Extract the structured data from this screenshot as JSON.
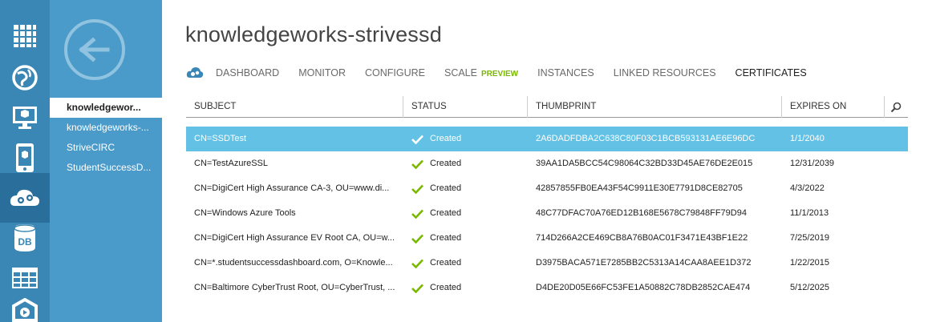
{
  "colors": {
    "rail": "#3a87b5",
    "rail_active": "#2a6f9b",
    "subnav": "#4a9bc9",
    "selected_row": "#62c1e4",
    "check_green": "#7ab800",
    "preview_badge": "#7ab800"
  },
  "rail_icons": [
    "all-items-icon",
    "web-sites-icon",
    "virtual-machines-icon",
    "mobile-services-icon",
    "cloud-services-icon",
    "sql-databases-icon",
    "storage-icon",
    "media-services-icon"
  ],
  "subnav": {
    "items": [
      {
        "label": "knowledgewor..."
      },
      {
        "label": "knowledgeworks-..."
      },
      {
        "label": "StriveCIRC"
      },
      {
        "label": "StudentSuccessD..."
      }
    ]
  },
  "page": {
    "title": "knowledgeworks-strivessd"
  },
  "tabs": [
    {
      "label": "DASHBOARD"
    },
    {
      "label": "MONITOR"
    },
    {
      "label": "CONFIGURE"
    },
    {
      "label": "SCALE",
      "badge": "PREVIEW"
    },
    {
      "label": "INSTANCES"
    },
    {
      "label": "LINKED RESOURCES"
    },
    {
      "label": "CERTIFICATES"
    }
  ],
  "grid": {
    "columns": [
      "SUBJECT",
      "STATUS",
      "THUMBPRINT",
      "EXPIRES ON"
    ],
    "rows": [
      {
        "subject": "CN=SSDTest",
        "status": "Created",
        "thumbprint": "2A6DADFDBA2C638C80F03C1BCB593131AE6E96DC",
        "expires": "1/1/2040"
      },
      {
        "subject": "CN=TestAzureSSL",
        "status": "Created",
        "thumbprint": "39AA1DA5BCC54C98064C32BD33D45AE76DE2E015",
        "expires": "12/31/2039"
      },
      {
        "subject": "CN=DigiCert High Assurance CA-3, OU=www.di...",
        "status": "Created",
        "thumbprint": "42857855FB0EA43F54C9911E30E7791D8CE82705",
        "expires": "4/3/2022"
      },
      {
        "subject": "CN=Windows Azure Tools",
        "status": "Created",
        "thumbprint": "48C77DFAC70A76ED12B168E5678C79848FF79D94",
        "expires": "11/1/2013"
      },
      {
        "subject": "CN=DigiCert High Assurance EV Root CA, OU=w...",
        "status": "Created",
        "thumbprint": "714D266A2CE469CB8A76B0AC01F3471E43BF1E22",
        "expires": "7/25/2019"
      },
      {
        "subject": "CN=*.studentsuccessdashboard.com, O=Knowle...",
        "status": "Created",
        "thumbprint": "D3975BACA571E7285BB2C5313A14CAA8AEE1D372",
        "expires": "1/22/2015"
      },
      {
        "subject": "CN=Baltimore CyberTrust Root, OU=CyberTrust, ...",
        "status": "Created",
        "thumbprint": "D4DE20D05E66FC53FE1A50882C78DB2852CAE474",
        "expires": "5/12/2025"
      }
    ]
  }
}
